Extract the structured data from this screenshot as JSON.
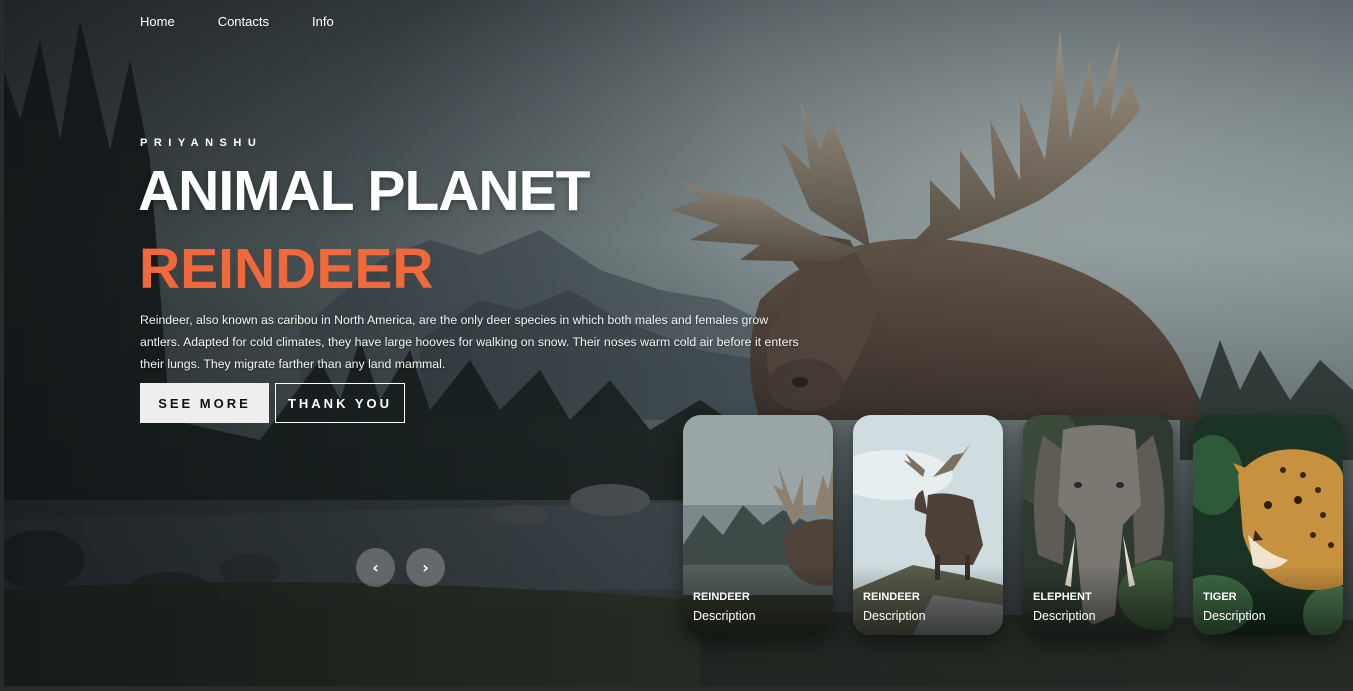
{
  "nav": {
    "items": [
      "Home",
      "Contacts",
      "Info"
    ]
  },
  "hero": {
    "eyebrow": "PRIYANSHU",
    "title": "ANIMAL PLANET",
    "topic": "REINDEER",
    "description": "Reindeer, also known as caribou in North America, are the only deer species in which both males and females grow antlers. Adapted for cold climates, they have large hooves for walking on snow. Their noses warm cold air before it enters their lungs. They migrate farther than any land mammal.",
    "accent_color": "#f1683a",
    "buttons": {
      "see_more": "SEE MORE",
      "thank_you": "THANK YOU"
    }
  },
  "controls": {
    "prev_icon": "‹",
    "next_icon": "›"
  },
  "thumbnails": [
    {
      "name": "REINDEER",
      "description": "Description",
      "icon": "reindeer-photo"
    },
    {
      "name": "REINDEER",
      "description": "Description",
      "icon": "moose-photo"
    },
    {
      "name": "ELEPHENT",
      "description": "Description",
      "icon": "elephant-photo"
    },
    {
      "name": "TIGER",
      "description": "Description",
      "icon": "tiger-photo"
    }
  ]
}
